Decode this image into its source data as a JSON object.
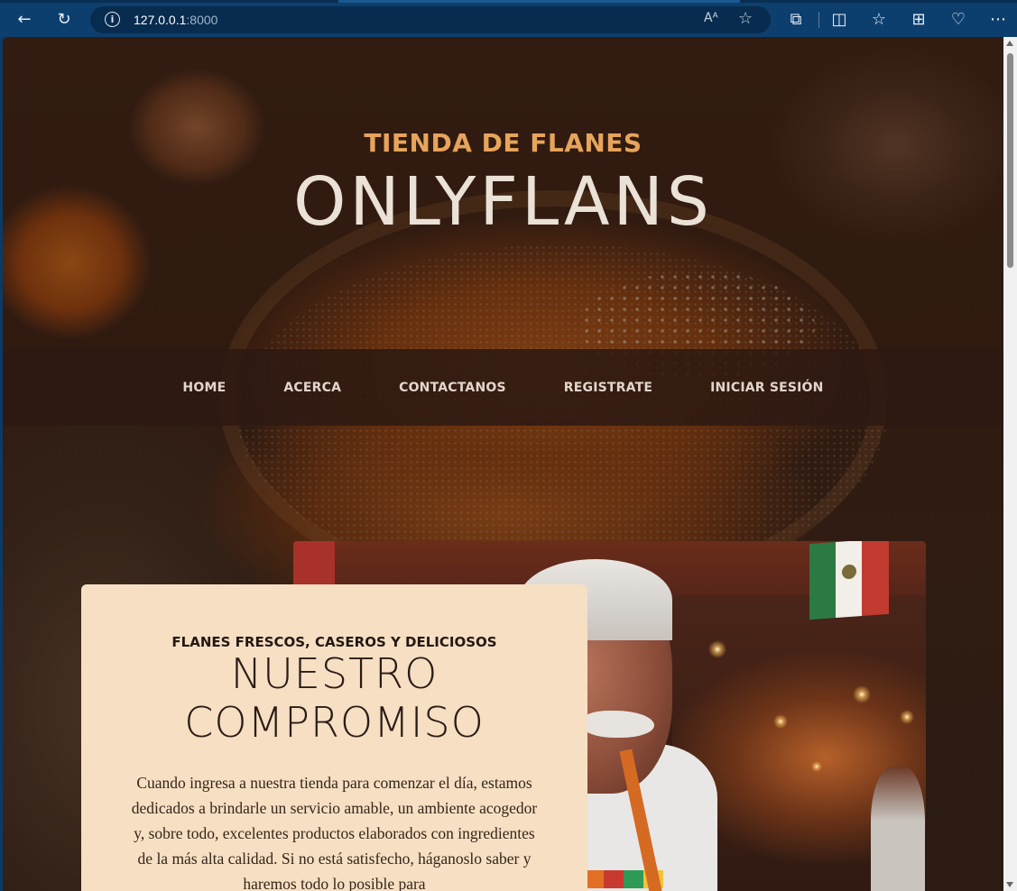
{
  "browser": {
    "url_host": "127.0.0.1",
    "url_port": ":8000",
    "back_icon": "←",
    "reload_icon": "↻",
    "info_icon": "i",
    "read_aloud_icon": "Aᴬ",
    "favorite_icon": "☆",
    "extensions_icon": "⧉",
    "split_icon": "◫",
    "favorites_icon": "☆",
    "collections_icon": "⊞",
    "performance_icon": "♡",
    "menu_icon": "⋯"
  },
  "hero": {
    "subtitle": "TIENDA DE FLANES",
    "title": "ONLYFLANS"
  },
  "nav": {
    "items": [
      "HOME",
      "ACERCA",
      "CONTACTANOS",
      "REGISTRATE",
      "INICIAR SESIÓN"
    ]
  },
  "about": {
    "kicker": "FLANES FRESCOS, CASEROS Y DELICIOSOS",
    "title_line1": "NUESTRO",
    "title_line2": "COMPROMISO",
    "body": "Cuando ingresa a nuestra tienda para comenzar el día, estamos dedicados a brindarle un servicio amable, un ambiente acogedor y, sobre todo, excelentes productos elaborados con ingredientes de la más alta calidad. Si no está satisfecho, háganoslo saber y haremos todo lo posible para"
  },
  "colors": {
    "accent": "#e7a45b",
    "card_bg": "#f6dfc3",
    "nav_bg": "#2d1912",
    "chrome_bg": "#0d3f6e"
  }
}
